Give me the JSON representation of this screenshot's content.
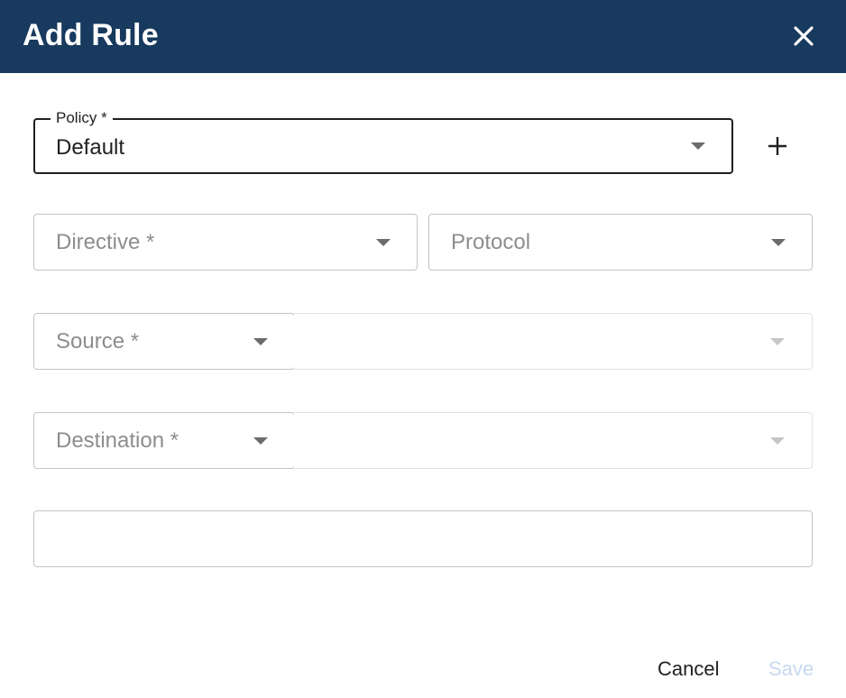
{
  "dialog": {
    "title": "Add Rule",
    "close_icon": "close-icon"
  },
  "policy": {
    "label": "Policy *",
    "value": "Default",
    "add_icon": "plus-icon"
  },
  "directive": {
    "placeholder": "Directive *"
  },
  "protocol": {
    "placeholder": "Protocol"
  },
  "source": {
    "placeholder": "Source *",
    "value_select": ""
  },
  "destination": {
    "placeholder": "Destination *",
    "value_select": ""
  },
  "description": {
    "value": ""
  },
  "actions": {
    "cancel_label": "Cancel",
    "save_label": "Save"
  },
  "colors": {
    "header_bg": "#173a5e",
    "save_disabled": "#c7d8ef"
  }
}
